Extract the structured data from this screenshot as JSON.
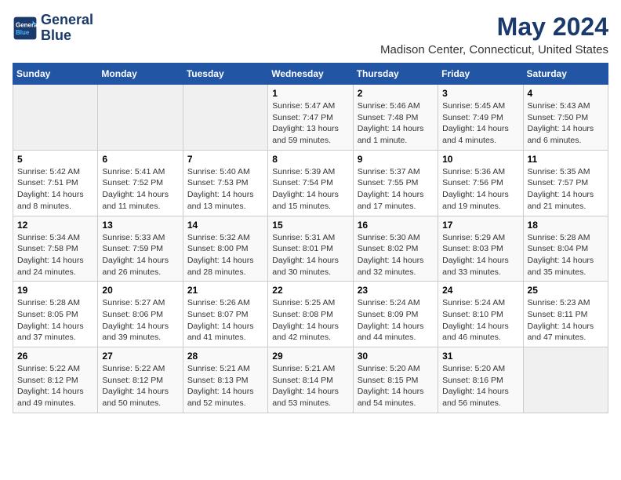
{
  "logo": {
    "line1": "General",
    "line2": "Blue"
  },
  "title": "May 2024",
  "subtitle": "Madison Center, Connecticut, United States",
  "weekdays": [
    "Sunday",
    "Monday",
    "Tuesday",
    "Wednesday",
    "Thursday",
    "Friday",
    "Saturday"
  ],
  "weeks": [
    [
      {
        "day": "",
        "info": ""
      },
      {
        "day": "",
        "info": ""
      },
      {
        "day": "",
        "info": ""
      },
      {
        "day": "1",
        "info": "Sunrise: 5:47 AM\nSunset: 7:47 PM\nDaylight: 13 hours\nand 59 minutes."
      },
      {
        "day": "2",
        "info": "Sunrise: 5:46 AM\nSunset: 7:48 PM\nDaylight: 14 hours\nand 1 minute."
      },
      {
        "day": "3",
        "info": "Sunrise: 5:45 AM\nSunset: 7:49 PM\nDaylight: 14 hours\nand 4 minutes."
      },
      {
        "day": "4",
        "info": "Sunrise: 5:43 AM\nSunset: 7:50 PM\nDaylight: 14 hours\nand 6 minutes."
      }
    ],
    [
      {
        "day": "5",
        "info": "Sunrise: 5:42 AM\nSunset: 7:51 PM\nDaylight: 14 hours\nand 8 minutes."
      },
      {
        "day": "6",
        "info": "Sunrise: 5:41 AM\nSunset: 7:52 PM\nDaylight: 14 hours\nand 11 minutes."
      },
      {
        "day": "7",
        "info": "Sunrise: 5:40 AM\nSunset: 7:53 PM\nDaylight: 14 hours\nand 13 minutes."
      },
      {
        "day": "8",
        "info": "Sunrise: 5:39 AM\nSunset: 7:54 PM\nDaylight: 14 hours\nand 15 minutes."
      },
      {
        "day": "9",
        "info": "Sunrise: 5:37 AM\nSunset: 7:55 PM\nDaylight: 14 hours\nand 17 minutes."
      },
      {
        "day": "10",
        "info": "Sunrise: 5:36 AM\nSunset: 7:56 PM\nDaylight: 14 hours\nand 19 minutes."
      },
      {
        "day": "11",
        "info": "Sunrise: 5:35 AM\nSunset: 7:57 PM\nDaylight: 14 hours\nand 21 minutes."
      }
    ],
    [
      {
        "day": "12",
        "info": "Sunrise: 5:34 AM\nSunset: 7:58 PM\nDaylight: 14 hours\nand 24 minutes."
      },
      {
        "day": "13",
        "info": "Sunrise: 5:33 AM\nSunset: 7:59 PM\nDaylight: 14 hours\nand 26 minutes."
      },
      {
        "day": "14",
        "info": "Sunrise: 5:32 AM\nSunset: 8:00 PM\nDaylight: 14 hours\nand 28 minutes."
      },
      {
        "day": "15",
        "info": "Sunrise: 5:31 AM\nSunset: 8:01 PM\nDaylight: 14 hours\nand 30 minutes."
      },
      {
        "day": "16",
        "info": "Sunrise: 5:30 AM\nSunset: 8:02 PM\nDaylight: 14 hours\nand 32 minutes."
      },
      {
        "day": "17",
        "info": "Sunrise: 5:29 AM\nSunset: 8:03 PM\nDaylight: 14 hours\nand 33 minutes."
      },
      {
        "day": "18",
        "info": "Sunrise: 5:28 AM\nSunset: 8:04 PM\nDaylight: 14 hours\nand 35 minutes."
      }
    ],
    [
      {
        "day": "19",
        "info": "Sunrise: 5:28 AM\nSunset: 8:05 PM\nDaylight: 14 hours\nand 37 minutes."
      },
      {
        "day": "20",
        "info": "Sunrise: 5:27 AM\nSunset: 8:06 PM\nDaylight: 14 hours\nand 39 minutes."
      },
      {
        "day": "21",
        "info": "Sunrise: 5:26 AM\nSunset: 8:07 PM\nDaylight: 14 hours\nand 41 minutes."
      },
      {
        "day": "22",
        "info": "Sunrise: 5:25 AM\nSunset: 8:08 PM\nDaylight: 14 hours\nand 42 minutes."
      },
      {
        "day": "23",
        "info": "Sunrise: 5:24 AM\nSunset: 8:09 PM\nDaylight: 14 hours\nand 44 minutes."
      },
      {
        "day": "24",
        "info": "Sunrise: 5:24 AM\nSunset: 8:10 PM\nDaylight: 14 hours\nand 46 minutes."
      },
      {
        "day": "25",
        "info": "Sunrise: 5:23 AM\nSunset: 8:11 PM\nDaylight: 14 hours\nand 47 minutes."
      }
    ],
    [
      {
        "day": "26",
        "info": "Sunrise: 5:22 AM\nSunset: 8:12 PM\nDaylight: 14 hours\nand 49 minutes."
      },
      {
        "day": "27",
        "info": "Sunrise: 5:22 AM\nSunset: 8:12 PM\nDaylight: 14 hours\nand 50 minutes."
      },
      {
        "day": "28",
        "info": "Sunrise: 5:21 AM\nSunset: 8:13 PM\nDaylight: 14 hours\nand 52 minutes."
      },
      {
        "day": "29",
        "info": "Sunrise: 5:21 AM\nSunset: 8:14 PM\nDaylight: 14 hours\nand 53 minutes."
      },
      {
        "day": "30",
        "info": "Sunrise: 5:20 AM\nSunset: 8:15 PM\nDaylight: 14 hours\nand 54 minutes."
      },
      {
        "day": "31",
        "info": "Sunrise: 5:20 AM\nSunset: 8:16 PM\nDaylight: 14 hours\nand 56 minutes."
      },
      {
        "day": "",
        "info": ""
      }
    ]
  ]
}
